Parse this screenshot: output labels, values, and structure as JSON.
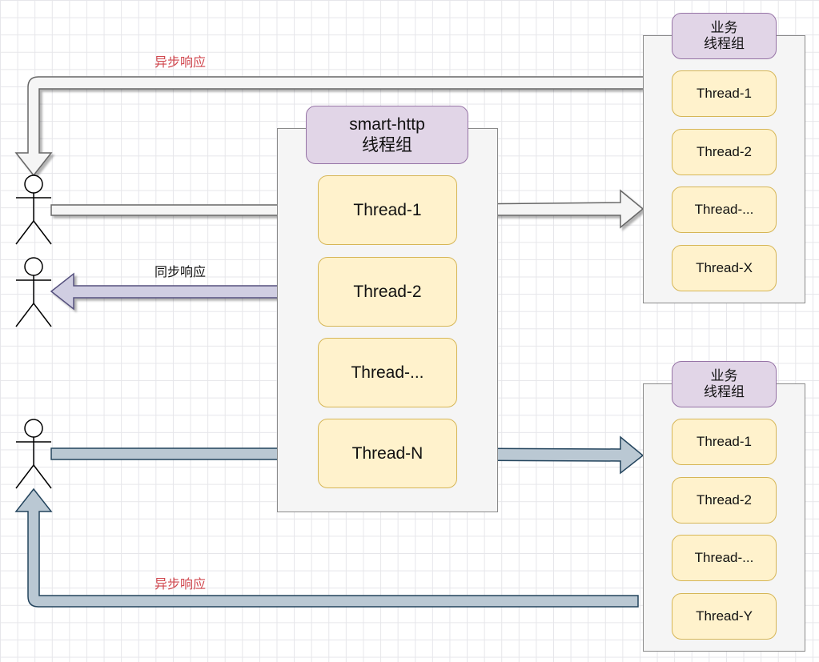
{
  "diagram": {
    "smart_http_group": {
      "title_line1": "smart-http",
      "title_line2": "线程组",
      "threads": [
        "Thread-1",
        "Thread-2",
        "Thread-...",
        "Thread-N"
      ]
    },
    "business_group_top": {
      "title_line1": "业务",
      "title_line2": "线程组",
      "threads": [
        "Thread-1",
        "Thread-2",
        "Thread-...",
        "Thread-X"
      ]
    },
    "business_group_bottom": {
      "title_line1": "业务",
      "title_line2": "线程组",
      "threads": [
        "Thread-1",
        "Thread-2",
        "Thread-...",
        "Thread-Y"
      ]
    },
    "labels": {
      "async_response_top": "异步响应",
      "sync_response": "同步响应",
      "async_response_bottom": "异步响应"
    },
    "colors": {
      "async_label": "#d0474e",
      "sync_label": "#111111",
      "header_fill": "#e1d5e7",
      "header_stroke": "#9673a6",
      "thread_fill": "#fff2cc",
      "thread_stroke": "#d6b656",
      "arrow_white_fill": "#f5f5f5",
      "arrow_purple_fill": "#d0cee2",
      "arrow_blue_fill": "#bac8d3"
    },
    "actors": [
      "user-1",
      "user-2",
      "user-3"
    ]
  }
}
